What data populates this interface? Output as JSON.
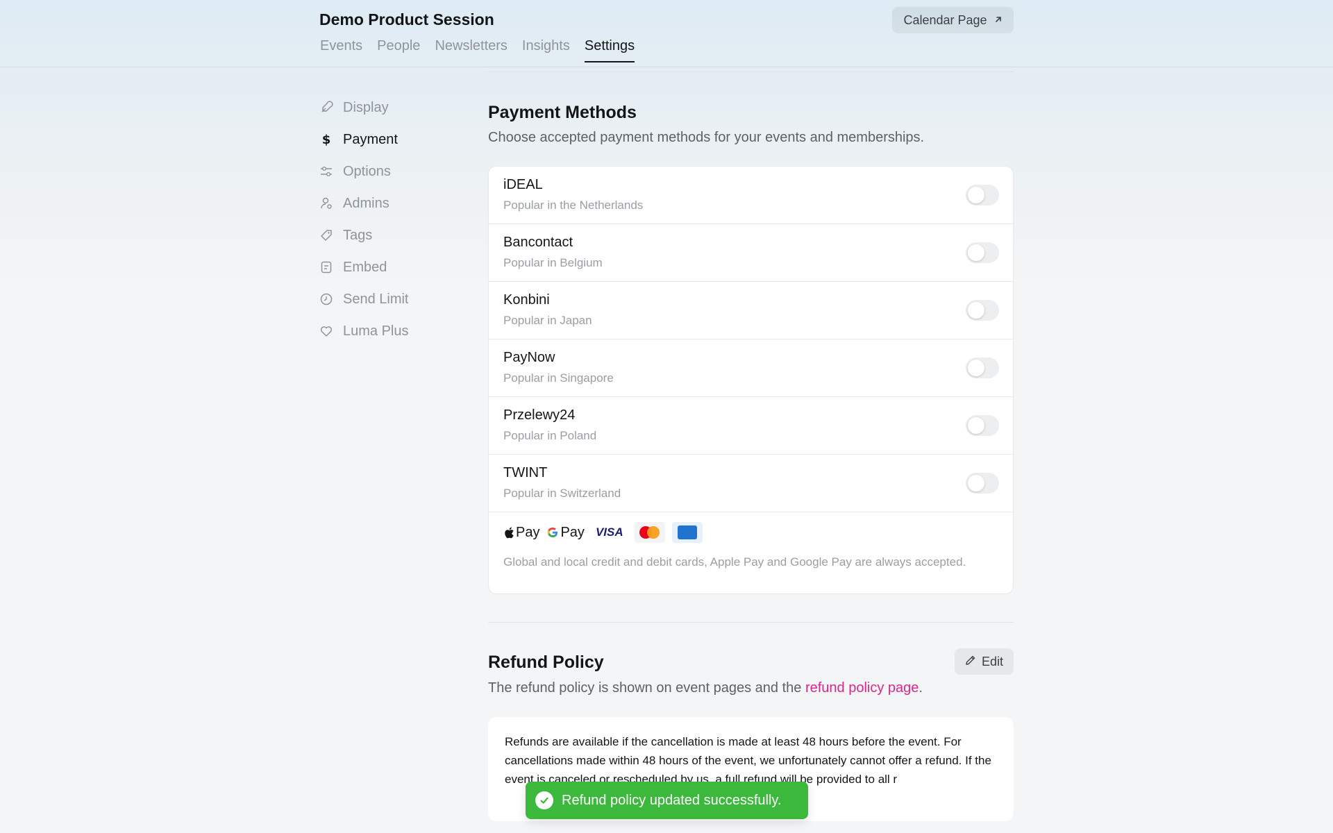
{
  "header": {
    "title": "Demo Product Session",
    "calendar_button": "Calendar Page",
    "tabs": [
      {
        "label": "Events",
        "active": false
      },
      {
        "label": "People",
        "active": false
      },
      {
        "label": "Newsletters",
        "active": false
      },
      {
        "label": "Insights",
        "active": false
      },
      {
        "label": "Settings",
        "active": true
      }
    ]
  },
  "sidebar": {
    "items": [
      {
        "label": "Display",
        "icon": "display-icon",
        "active": false
      },
      {
        "label": "Payment",
        "icon": "dollar-icon",
        "active": true
      },
      {
        "label": "Options",
        "icon": "sliders-icon",
        "active": false
      },
      {
        "label": "Admins",
        "icon": "admins-icon",
        "active": false
      },
      {
        "label": "Tags",
        "icon": "tag-icon",
        "active": false
      },
      {
        "label": "Embed",
        "icon": "embed-icon",
        "active": false
      },
      {
        "label": "Send Limit",
        "icon": "clock-icon",
        "active": false
      },
      {
        "label": "Luma Plus",
        "icon": "heart-icon",
        "active": false
      }
    ]
  },
  "payment_methods": {
    "title": "Payment Methods",
    "subtitle": "Choose accepted payment methods for your events and memberships.",
    "methods": [
      {
        "name": "iDEAL",
        "description": "Popular in the Netherlands",
        "enabled": false
      },
      {
        "name": "Bancontact",
        "description": "Popular in Belgium",
        "enabled": false
      },
      {
        "name": "Konbini",
        "description": "Popular in Japan",
        "enabled": false
      },
      {
        "name": "PayNow",
        "description": "Popular in Singapore",
        "enabled": false
      },
      {
        "name": "Przelewy24",
        "description": "Popular in Poland",
        "enabled": false
      },
      {
        "name": "TWINT",
        "description": "Popular in Switzerland",
        "enabled": false
      }
    ],
    "card_logos": {
      "apple_pay": "Pay",
      "google_pay": "Pay",
      "visa": "VISA"
    },
    "cards_note": "Global and local credit and debit cards, Apple Pay and Google Pay are always accepted."
  },
  "refund_policy": {
    "title": "Refund Policy",
    "edit_button": "Edit",
    "subtitle_prefix": "The refund policy is shown on event pages and the ",
    "subtitle_link": "refund policy page",
    "subtitle_suffix": ".",
    "policy_text": "Refunds are available if the cancellation is made at least 48 hours before the event. For cancellations made within 48 hours of the event, we unfortunately cannot offer a refund. If the event is canceled or rescheduled by us, a full refund will be provided to all r"
  },
  "toast": {
    "message": "Refund policy updated successfully."
  },
  "colors": {
    "accent_link": "#e0248a",
    "toast_green": "#3cb83c"
  }
}
